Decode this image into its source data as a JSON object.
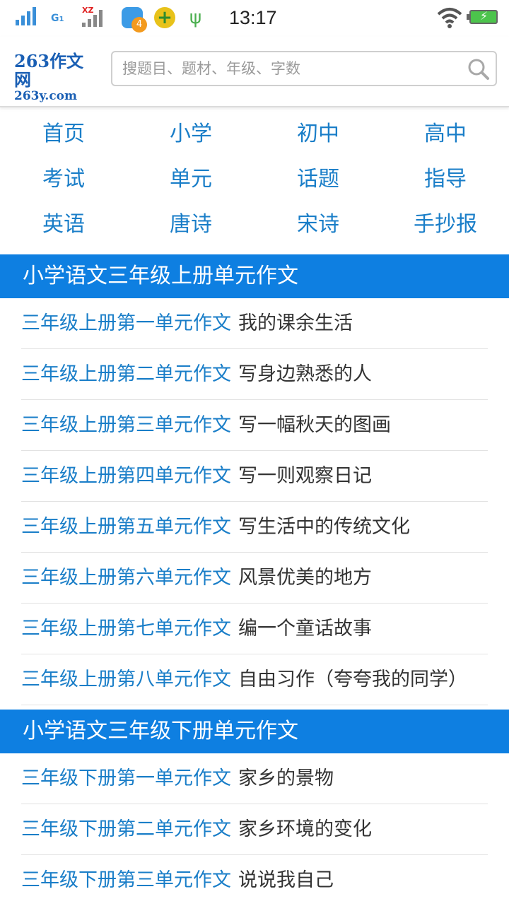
{
  "status_bar": {
    "network_type": "G",
    "network_sub": "1",
    "carrier_tag": "XZ",
    "notification_count": "4",
    "time": "13:17",
    "icons": [
      "signal-icon",
      "signal-icon",
      "app-notification-icon",
      "plus-app-icon",
      "usb-icon",
      "wifi-icon",
      "battery-charging-icon"
    ]
  },
  "header": {
    "logo_main": "263作文网",
    "logo_sub": "263y.com",
    "search_placeholder": "搜题目、题材、年级、字数"
  },
  "nav": {
    "rows": [
      [
        "首页",
        "小学",
        "初中",
        "高中"
      ],
      [
        "考试",
        "单元",
        "话题",
        "指导"
      ],
      [
        "英语",
        "唐诗",
        "宋诗",
        "手抄报"
      ]
    ]
  },
  "sections": [
    {
      "title": "小学语文三年级上册单元作文",
      "items": [
        {
          "link": "三年级上册第一单元作文",
          "topic": "我的课余生活"
        },
        {
          "link": "三年级上册第二单元作文",
          "topic": "写身边熟悉的人"
        },
        {
          "link": "三年级上册第三单元作文",
          "topic": "写一幅秋天的图画"
        },
        {
          "link": "三年级上册第四单元作文",
          "topic": "写一则观察日记"
        },
        {
          "link": "三年级上册第五单元作文",
          "topic": "写生活中的传统文化"
        },
        {
          "link": "三年级上册第六单元作文",
          "topic": "风景优美的地方"
        },
        {
          "link": "三年级上册第七单元作文",
          "topic": "编一个童话故事"
        },
        {
          "link": "三年级上册第八单元作文",
          "topic": "自由习作（夸夸我的同学）"
        }
      ]
    },
    {
      "title": "小学语文三年级下册单元作文",
      "items": [
        {
          "link": "三年级下册第一单元作文",
          "topic": "家乡的景物"
        },
        {
          "link": "三年级下册第二单元作文",
          "topic": "家乡环境的变化"
        },
        {
          "link": "三年级下册第三单元作文",
          "topic": "说说我自己"
        }
      ]
    }
  ],
  "colors": {
    "accent": "#0e7fe1",
    "link": "#1a7ec8",
    "logo": "#1a5fb4"
  }
}
